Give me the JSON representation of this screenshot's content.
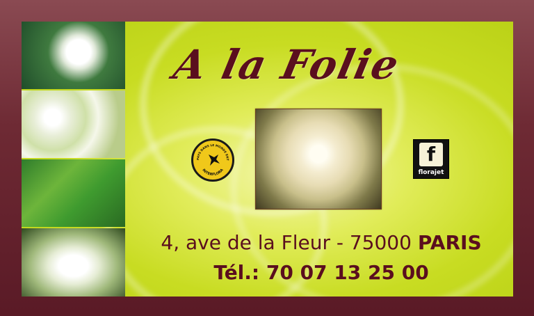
{
  "card": {
    "title": "A la Folie",
    "address_main": "4, ave de la Fleur - 75000 ",
    "address_city": "PARIS",
    "phone": "Tél.: 70 07 13 25 00"
  },
  "logos": {
    "interflora_ring_text": "UN PAYS DANS LE MONDE ENTIER",
    "interflora_name": "INTERFLORA",
    "florajet_mark": "f",
    "florajet_name": "florajet"
  },
  "colors": {
    "frame": "#6e2a34",
    "card_background": "#c8dc22",
    "text": "#5a0e1e"
  }
}
